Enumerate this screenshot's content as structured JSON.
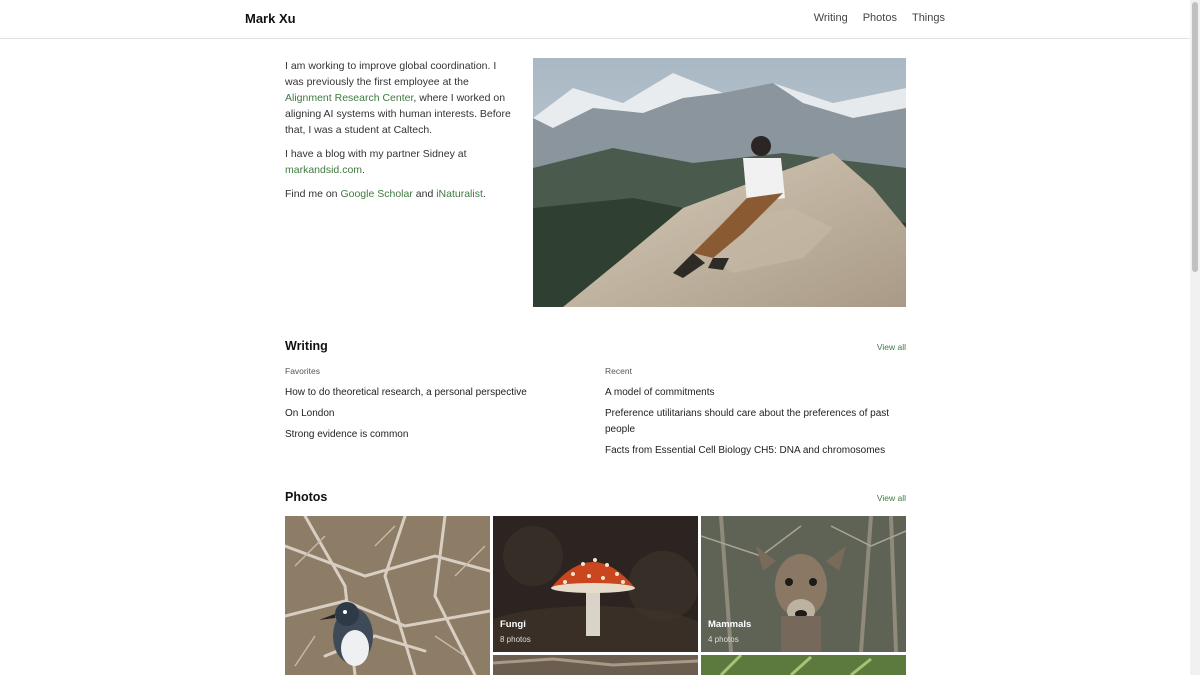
{
  "header": {
    "brand": "Mark Xu",
    "nav": [
      "Writing",
      "Photos",
      "Things"
    ]
  },
  "intro": {
    "p1_text_a": "I am working to improve global coordination. I was previously the first employee at the ",
    "p1_link": "Alignment Research Center",
    "p1_text_b": ", where I worked on aligning AI systems with human interests. Before that, I was a student at Caltech.",
    "p2_text_a": "I have a blog with my partner Sidney at ",
    "p2_link": "markandsid.com",
    "p2_text_b": ".",
    "p3_text_a": "Find me on ",
    "p3_link1": "Google Scholar",
    "p3_text_b": " and ",
    "p3_link2": "iNaturalist",
    "p3_text_c": "."
  },
  "writing": {
    "title": "Writing",
    "view_all": "View all",
    "favorites_label": "Favorites",
    "favorites": [
      "How to do theoretical research, a personal perspective",
      "On London",
      "Strong evidence is common"
    ],
    "recent_label": "Recent",
    "recent": [
      "A model of commitments",
      "Preference utilitarians should care about the preferences of past people",
      "Facts from Essential Cell Biology CH5: DNA and chromosomes"
    ]
  },
  "photos": {
    "title": "Photos",
    "view_all": "View all",
    "albums": [
      {
        "title": "Fungi",
        "count": "8 photos"
      },
      {
        "title": "Mammals",
        "count": "4 photos"
      }
    ]
  },
  "colors": {
    "link": "#3f7a3f",
    "text": "#333333"
  }
}
